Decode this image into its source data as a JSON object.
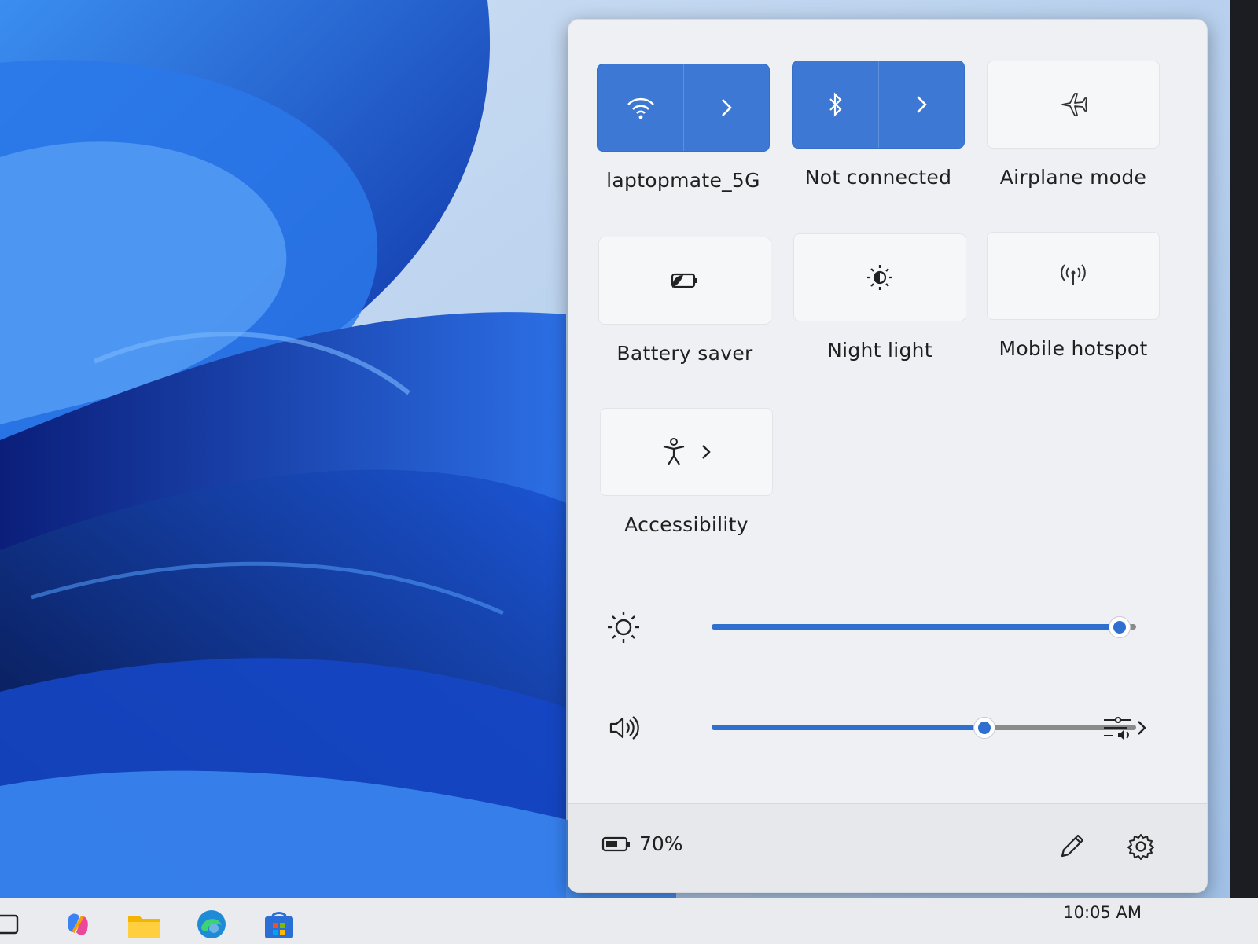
{
  "quick_settings": {
    "tiles": [
      {
        "id": "wifi",
        "label": "laptopmate_5G",
        "icon": "wifi-icon",
        "active": true,
        "expandable": true
      },
      {
        "id": "bluetooth",
        "label": "Not connected",
        "icon": "bluetooth-icon",
        "active": true,
        "expandable": true
      },
      {
        "id": "airplane",
        "label": "Airplane mode",
        "icon": "airplane-icon",
        "active": false,
        "expandable": false
      },
      {
        "id": "battery-saver",
        "label": "Battery saver",
        "icon": "battery-saver-icon",
        "active": false,
        "expandable": false
      },
      {
        "id": "night-light",
        "label": "Night light",
        "icon": "night-light-icon",
        "active": false,
        "expandable": false
      },
      {
        "id": "hotspot",
        "label": "Mobile hotspot",
        "icon": "hotspot-icon",
        "active": false,
        "expandable": false
      },
      {
        "id": "accessibility",
        "label": "Accessibility",
        "icon": "accessibility-icon",
        "active": false,
        "expandable": true
      }
    ],
    "brightness": {
      "icon": "brightness-icon",
      "level_percent": 96
    },
    "volume": {
      "icon": "speaker-icon",
      "level_percent": 64,
      "output_icon": "audio-output-icon"
    }
  },
  "footer": {
    "battery_text": "70%",
    "battery_icon": "battery-icon",
    "edit_icon": "pencil-icon",
    "settings_icon": "gear-icon"
  },
  "taskbar": {
    "clock": "10:05 AM"
  },
  "colors": {
    "accent": "#3c78d4",
    "slider_fill": "#2f6fd0",
    "flyout_bg": "#eef0f4"
  }
}
